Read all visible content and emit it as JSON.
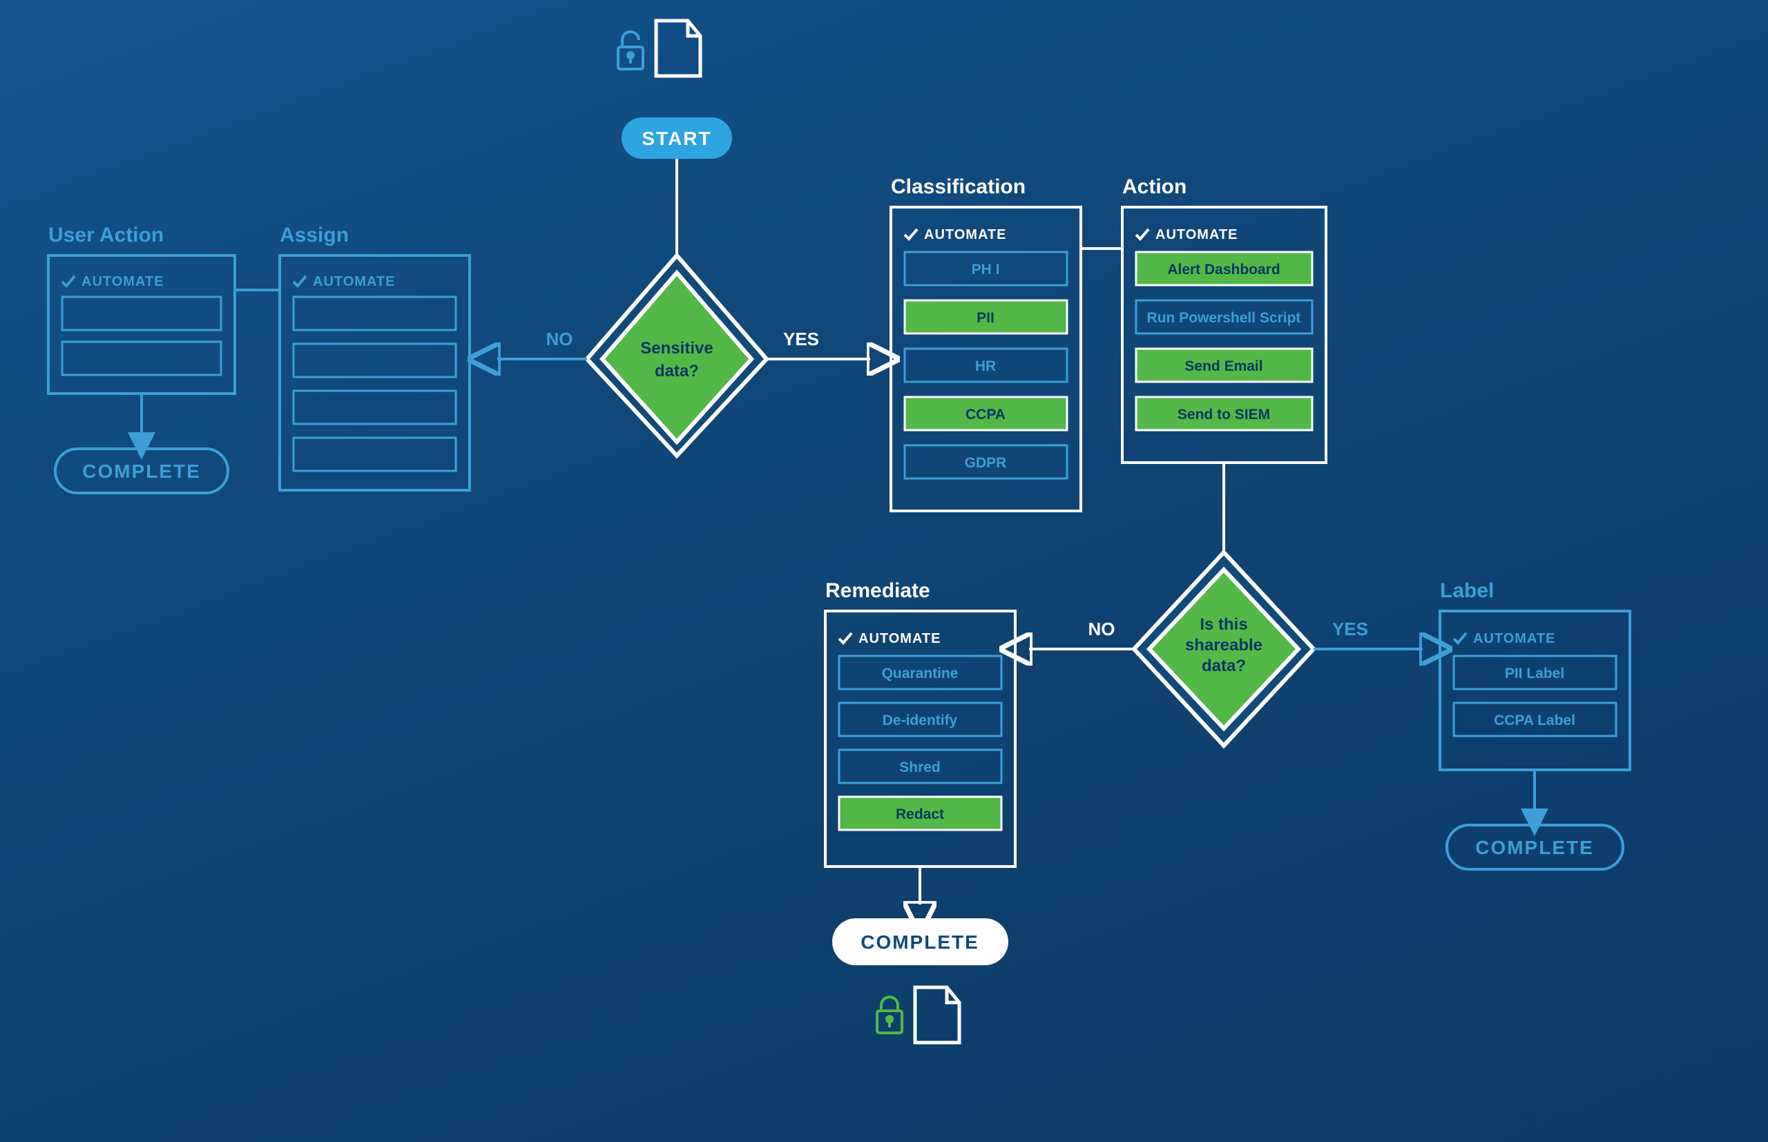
{
  "start_label": "START",
  "complete_label": "COMPLETE",
  "automate_label": "AUTOMATE",
  "yes_label": "YES",
  "no_label": "NO",
  "decision1": {
    "line1": "Sensitive",
    "line2": "data?"
  },
  "decision2": {
    "line1": "Is this",
    "line2": "shareable",
    "line3": "data?"
  },
  "panels": {
    "user_action": {
      "title": "User Action",
      "items": [
        "",
        ""
      ]
    },
    "assign": {
      "title": "Assign",
      "items": [
        "",
        "",
        "",
        ""
      ]
    },
    "classification": {
      "title": "Classification",
      "items": [
        {
          "label": "PH I",
          "selected": false
        },
        {
          "label": "PII",
          "selected": true
        },
        {
          "label": "HR",
          "selected": false
        },
        {
          "label": "CCPA",
          "selected": true
        },
        {
          "label": "GDPR",
          "selected": false
        }
      ]
    },
    "action": {
      "title": "Action",
      "items": [
        {
          "label": "Alert Dashboard",
          "selected": true
        },
        {
          "label": "Run Powershell Script",
          "selected": false
        },
        {
          "label": "Send Email",
          "selected": true
        },
        {
          "label": "Send to SIEM",
          "selected": true
        }
      ]
    },
    "remediate": {
      "title": "Remediate",
      "items": [
        {
          "label": "Quarantine",
          "selected": false
        },
        {
          "label": "De-identify",
          "selected": false
        },
        {
          "label": "Shred",
          "selected": false
        },
        {
          "label": "Redact",
          "selected": true
        }
      ]
    },
    "label": {
      "title": "Label",
      "items": [
        {
          "label": "PII Label",
          "selected": false
        },
        {
          "label": "CCPA Label",
          "selected": false
        }
      ]
    }
  },
  "colors": {
    "green": "#53b848",
    "lightblue": "#3d9fd6",
    "accent": "#2da5e1",
    "white": "#ffffff",
    "darkblue": "#0c4a7d"
  }
}
